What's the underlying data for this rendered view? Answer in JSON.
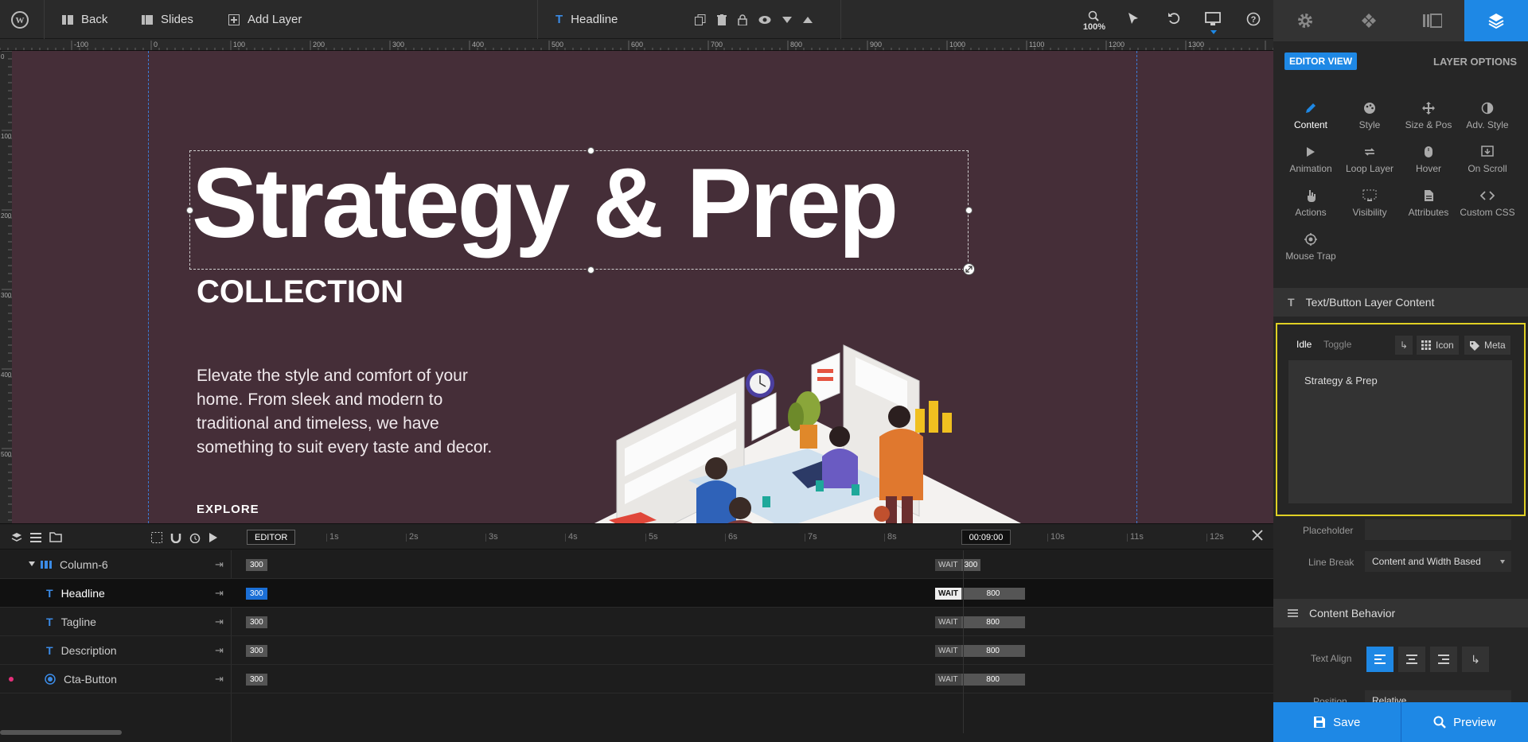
{
  "toolbar": {
    "back_label": "Back",
    "slides_label": "Slides",
    "add_layer_label": "Add Layer",
    "layer_name": "Headline",
    "zoom": "100%"
  },
  "ruler": {
    "h_ticks": [
      "-100",
      "0",
      "100",
      "200",
      "300",
      "400",
      "500",
      "600",
      "700",
      "800",
      "900",
      "1000",
      "1100",
      "1200",
      "1300"
    ],
    "v_ticks": [
      "0",
      "100",
      "200",
      "300",
      "400",
      "500"
    ]
  },
  "slide": {
    "headline": "Strategy & Prep",
    "tagline": "COLLECTION",
    "description": "Elevate the style and comfort of your home. From sleek and modern to traditional and timeless, we have something to suit every taste and decor.",
    "cta": "EXPLORE"
  },
  "timeline": {
    "editor_label": "EDITOR",
    "seconds": [
      "1s",
      "2s",
      "3s",
      "4s",
      "5s",
      "6s",
      "7s",
      "8s",
      "10s",
      "11s",
      "12s"
    ],
    "current_time": "00:09:00",
    "rows": [
      {
        "label": "Column-6",
        "start": "300",
        "wait": "WAIT",
        "duration": "300"
      },
      {
        "label": "Headline",
        "start": "300",
        "wait": "WAIT",
        "duration": "800"
      },
      {
        "label": "Tagline",
        "start": "300",
        "wait": "WAIT",
        "duration": "800"
      },
      {
        "label": "Description",
        "start": "300",
        "wait": "WAIT",
        "duration": "800"
      },
      {
        "label": "Cta-Button",
        "start": "300",
        "wait": "WAIT",
        "duration": "800"
      }
    ]
  },
  "panel": {
    "editor_view": "EDITOR VIEW",
    "layer_options": "LAYER OPTIONS",
    "options": [
      {
        "label": "Content",
        "icon": "pencil-icon"
      },
      {
        "label": "Style",
        "icon": "palette-icon"
      },
      {
        "label": "Size & Pos",
        "icon": "move-icon"
      },
      {
        "label": "Adv. Style",
        "icon": "contrast-icon"
      },
      {
        "label": "Animation",
        "icon": "play-icon"
      },
      {
        "label": "Loop Layer",
        "icon": "loop-icon"
      },
      {
        "label": "Hover",
        "icon": "mouse-icon"
      },
      {
        "label": "On Scroll",
        "icon": "scroll-icon"
      },
      {
        "label": "Actions",
        "icon": "hand-icon"
      },
      {
        "label": "Visibility",
        "icon": "visibility-icon"
      },
      {
        "label": "Attributes",
        "icon": "file-icon"
      },
      {
        "label": "Custom CSS",
        "icon": "code-icon"
      },
      {
        "label": "Mouse Trap",
        "icon": "target-icon"
      }
    ],
    "section_content": "Text/Button Layer Content",
    "tab_idle": "Idle",
    "tab_toggle": "Toggle",
    "icon_btn": "Icon",
    "meta_btn": "Meta",
    "text_value": "Strategy & Prep",
    "placeholder_label": "Placeholder",
    "placeholder_value": "",
    "line_break_label": "Line Break",
    "line_break_value": "Content and Width Based",
    "section_behavior": "Content Behavior",
    "text_align_label": "Text Align",
    "position_label": "Position",
    "position_value": "Relative",
    "save_label": "Save",
    "preview_label": "Preview"
  },
  "colors": {
    "accent": "#1e88e5",
    "slide_bg": "#452e38",
    "highlight": "#e0d024"
  }
}
